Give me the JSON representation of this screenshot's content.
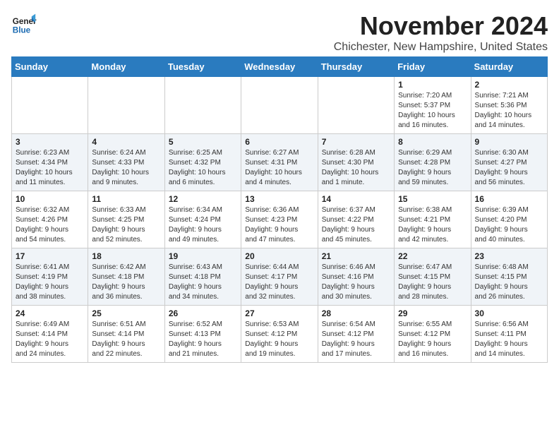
{
  "logo": {
    "text_general": "General",
    "text_blue": "Blue"
  },
  "header": {
    "month": "November 2024",
    "location": "Chichester, New Hampshire, United States"
  },
  "weekdays": [
    "Sunday",
    "Monday",
    "Tuesday",
    "Wednesday",
    "Thursday",
    "Friday",
    "Saturday"
  ],
  "weeks": [
    [
      {
        "day": "",
        "info": ""
      },
      {
        "day": "",
        "info": ""
      },
      {
        "day": "",
        "info": ""
      },
      {
        "day": "",
        "info": ""
      },
      {
        "day": "",
        "info": ""
      },
      {
        "day": "1",
        "info": "Sunrise: 7:20 AM\nSunset: 5:37 PM\nDaylight: 10 hours\nand 16 minutes."
      },
      {
        "day": "2",
        "info": "Sunrise: 7:21 AM\nSunset: 5:36 PM\nDaylight: 10 hours\nand 14 minutes."
      }
    ],
    [
      {
        "day": "3",
        "info": "Sunrise: 6:23 AM\nSunset: 4:34 PM\nDaylight: 10 hours\nand 11 minutes."
      },
      {
        "day": "4",
        "info": "Sunrise: 6:24 AM\nSunset: 4:33 PM\nDaylight: 10 hours\nand 9 minutes."
      },
      {
        "day": "5",
        "info": "Sunrise: 6:25 AM\nSunset: 4:32 PM\nDaylight: 10 hours\nand 6 minutes."
      },
      {
        "day": "6",
        "info": "Sunrise: 6:27 AM\nSunset: 4:31 PM\nDaylight: 10 hours\nand 4 minutes."
      },
      {
        "day": "7",
        "info": "Sunrise: 6:28 AM\nSunset: 4:30 PM\nDaylight: 10 hours\nand 1 minute."
      },
      {
        "day": "8",
        "info": "Sunrise: 6:29 AM\nSunset: 4:28 PM\nDaylight: 9 hours\nand 59 minutes."
      },
      {
        "day": "9",
        "info": "Sunrise: 6:30 AM\nSunset: 4:27 PM\nDaylight: 9 hours\nand 56 minutes."
      }
    ],
    [
      {
        "day": "10",
        "info": "Sunrise: 6:32 AM\nSunset: 4:26 PM\nDaylight: 9 hours\nand 54 minutes."
      },
      {
        "day": "11",
        "info": "Sunrise: 6:33 AM\nSunset: 4:25 PM\nDaylight: 9 hours\nand 52 minutes."
      },
      {
        "day": "12",
        "info": "Sunrise: 6:34 AM\nSunset: 4:24 PM\nDaylight: 9 hours\nand 49 minutes."
      },
      {
        "day": "13",
        "info": "Sunrise: 6:36 AM\nSunset: 4:23 PM\nDaylight: 9 hours\nand 47 minutes."
      },
      {
        "day": "14",
        "info": "Sunrise: 6:37 AM\nSunset: 4:22 PM\nDaylight: 9 hours\nand 45 minutes."
      },
      {
        "day": "15",
        "info": "Sunrise: 6:38 AM\nSunset: 4:21 PM\nDaylight: 9 hours\nand 42 minutes."
      },
      {
        "day": "16",
        "info": "Sunrise: 6:39 AM\nSunset: 4:20 PM\nDaylight: 9 hours\nand 40 minutes."
      }
    ],
    [
      {
        "day": "17",
        "info": "Sunrise: 6:41 AM\nSunset: 4:19 PM\nDaylight: 9 hours\nand 38 minutes."
      },
      {
        "day": "18",
        "info": "Sunrise: 6:42 AM\nSunset: 4:18 PM\nDaylight: 9 hours\nand 36 minutes."
      },
      {
        "day": "19",
        "info": "Sunrise: 6:43 AM\nSunset: 4:18 PM\nDaylight: 9 hours\nand 34 minutes."
      },
      {
        "day": "20",
        "info": "Sunrise: 6:44 AM\nSunset: 4:17 PM\nDaylight: 9 hours\nand 32 minutes."
      },
      {
        "day": "21",
        "info": "Sunrise: 6:46 AM\nSunset: 4:16 PM\nDaylight: 9 hours\nand 30 minutes."
      },
      {
        "day": "22",
        "info": "Sunrise: 6:47 AM\nSunset: 4:15 PM\nDaylight: 9 hours\nand 28 minutes."
      },
      {
        "day": "23",
        "info": "Sunrise: 6:48 AM\nSunset: 4:15 PM\nDaylight: 9 hours\nand 26 minutes."
      }
    ],
    [
      {
        "day": "24",
        "info": "Sunrise: 6:49 AM\nSunset: 4:14 PM\nDaylight: 9 hours\nand 24 minutes."
      },
      {
        "day": "25",
        "info": "Sunrise: 6:51 AM\nSunset: 4:14 PM\nDaylight: 9 hours\nand 22 minutes."
      },
      {
        "day": "26",
        "info": "Sunrise: 6:52 AM\nSunset: 4:13 PM\nDaylight: 9 hours\nand 21 minutes."
      },
      {
        "day": "27",
        "info": "Sunrise: 6:53 AM\nSunset: 4:12 PM\nDaylight: 9 hours\nand 19 minutes."
      },
      {
        "day": "28",
        "info": "Sunrise: 6:54 AM\nSunset: 4:12 PM\nDaylight: 9 hours\nand 17 minutes."
      },
      {
        "day": "29",
        "info": "Sunrise: 6:55 AM\nSunset: 4:12 PM\nDaylight: 9 hours\nand 16 minutes."
      },
      {
        "day": "30",
        "info": "Sunrise: 6:56 AM\nSunset: 4:11 PM\nDaylight: 9 hours\nand 14 minutes."
      }
    ]
  ]
}
